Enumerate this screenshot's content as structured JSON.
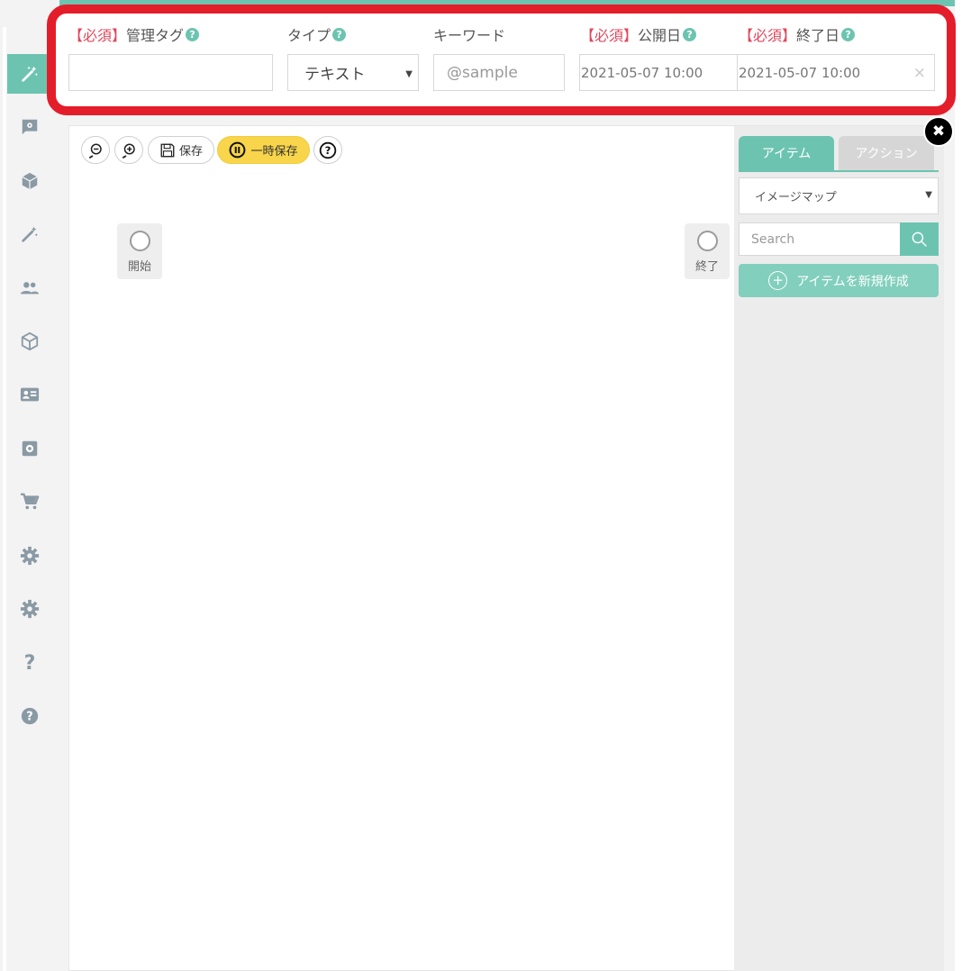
{
  "form": {
    "tag_label_req": "【必須】",
    "tag_label": "管理タグ",
    "type_label": "タイプ",
    "type_value": "テキスト",
    "keyword_label": "キーワード",
    "keyword_placeholder": "@sample",
    "publish_label_req": "【必須】",
    "publish_label": "公開日",
    "publish_value": "2021-05-07 10:00",
    "end_label_req": "【必須】",
    "end_label": "終了日",
    "end_value": "2021-05-07 10:00",
    "help": "?",
    "clear": "×"
  },
  "toolbar": {
    "save_label": "保存",
    "temp_save_label": "一時保存"
  },
  "canvas": {
    "start_label": "開始",
    "end_label": "終了"
  },
  "right_panel": {
    "tab_items": "アイテム",
    "tab_actions": "アクション",
    "select_value": "イメージマップ",
    "search_placeholder": "Search",
    "new_item_label": "アイテムを新規作成",
    "plus": "+"
  },
  "sidebar": {
    "items": [
      "magic-wand-icon",
      "chat-settings-icon",
      "box-icon",
      "magic-wand-icon",
      "users-icon",
      "cube-icon",
      "id-card-icon",
      "settings-box-icon",
      "cart-icon",
      "gear-icon",
      "gear-icon",
      "question-icon",
      "help-circle-icon"
    ],
    "question_glyph": "?"
  },
  "colors": {
    "accent": "#6cc4b0",
    "highlight_border": "#e41d2a",
    "required_text": "#e0475c",
    "temp_save": "#f8d54a"
  }
}
